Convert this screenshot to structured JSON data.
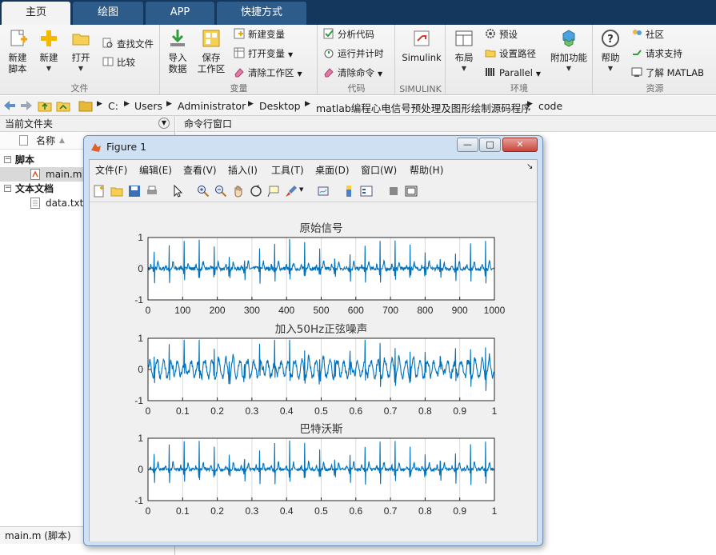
{
  "tabs": [
    {
      "label": "主页",
      "active": true
    },
    {
      "label": "绘图",
      "active": false
    },
    {
      "label": "APP",
      "active": false
    },
    {
      "label": "快捷方式",
      "active": false
    }
  ],
  "ribbon": {
    "file": {
      "group_label": "文件",
      "new_script": "新建\n脚本",
      "new": "新建",
      "open": "打开",
      "find_files": "查找文件",
      "compare": "比较"
    },
    "variable": {
      "group_label": "变量",
      "import": "导入\n数据",
      "save_ws": "保存\n工作区",
      "new_var": "新建变量",
      "open_var": "打开变量",
      "clear_ws": "清除工作区"
    },
    "code": {
      "group_label": "代码",
      "analyze": "分析代码",
      "run_time": "运行并计时",
      "clear_cmd": "清除命令"
    },
    "simulink": {
      "group_label": "SIMULINK",
      "simulink": "Simulink"
    },
    "env": {
      "group_label": "环境",
      "layout": "布局",
      "prefs": "预设",
      "set_path": "设置路径",
      "parallel": "Parallel",
      "addons": "附加功能"
    },
    "resources": {
      "group_label": "资源",
      "help": "帮助",
      "community": "社区",
      "support": "请求支持",
      "learn": "了解 MATLAB"
    }
  },
  "address": {
    "crumbs": [
      "C:",
      "Users",
      "Administrator",
      "Desktop",
      "matlab编程心电信号预处理及图形绘制源码程序",
      "code"
    ]
  },
  "left_panel": {
    "title": "当前文件夹",
    "col_name": "名称",
    "sort_indicator": "▲",
    "groups": [
      {
        "label": "脚本",
        "items": [
          "main.m"
        ]
      },
      {
        "label": "文本文档",
        "items": [
          "data.txt"
        ]
      }
    ],
    "detail": "main.m  (脚本)"
  },
  "command_window": {
    "title": "命令行窗口"
  },
  "figure": {
    "title": "Figure 1",
    "menus": [
      "文件(F)",
      "编辑(E)",
      "查看(V)",
      "插入(I)",
      "工具(T)",
      "桌面(D)",
      "窗口(W)",
      "帮助(H)"
    ],
    "win_buttons": {
      "min": "—",
      "max": "□",
      "close": "✕"
    }
  },
  "icons": {
    "back": "back-arrow-icon",
    "forward": "forward-arrow-icon"
  },
  "colors": {
    "tabbar_bg": "#14375e",
    "trace": "#0072bd",
    "axes_grid": "#d8d8d8"
  },
  "chart_data": [
    {
      "type": "line",
      "title": "原始信号",
      "xlim": [
        0,
        1000
      ],
      "ylim": [
        -1,
        1
      ],
      "xticks": [
        0,
        100,
        200,
        300,
        400,
        500,
        600,
        700,
        800,
        900,
        1000
      ],
      "yticks": [
        -1,
        0,
        1
      ],
      "grid": true,
      "period": 43.5,
      "noise": 0.06,
      "sine50": 0
    },
    {
      "type": "line",
      "title": "加入50Hz正弦噪声",
      "xlim": [
        0,
        1
      ],
      "ylim": [
        -1,
        1
      ],
      "xticks": [
        0,
        0.1,
        0.2,
        0.3,
        0.4,
        0.5,
        0.6,
        0.7,
        0.8,
        0.9,
        1
      ],
      "yticks": [
        -1,
        0,
        1
      ],
      "grid": true,
      "period": 0.0435,
      "noise": 0.08,
      "sine50": 0.25
    },
    {
      "type": "line",
      "title": "巴特沃斯",
      "xlim": [
        0,
        1
      ],
      "ylim": [
        -1,
        1
      ],
      "xticks": [
        0,
        0.1,
        0.2,
        0.3,
        0.4,
        0.5,
        0.6,
        0.7,
        0.8,
        0.9,
        1
      ],
      "yticks": [
        -1,
        0,
        1
      ],
      "grid": true,
      "period": 0.0435,
      "noise": 0.05,
      "sine50": 0
    }
  ]
}
